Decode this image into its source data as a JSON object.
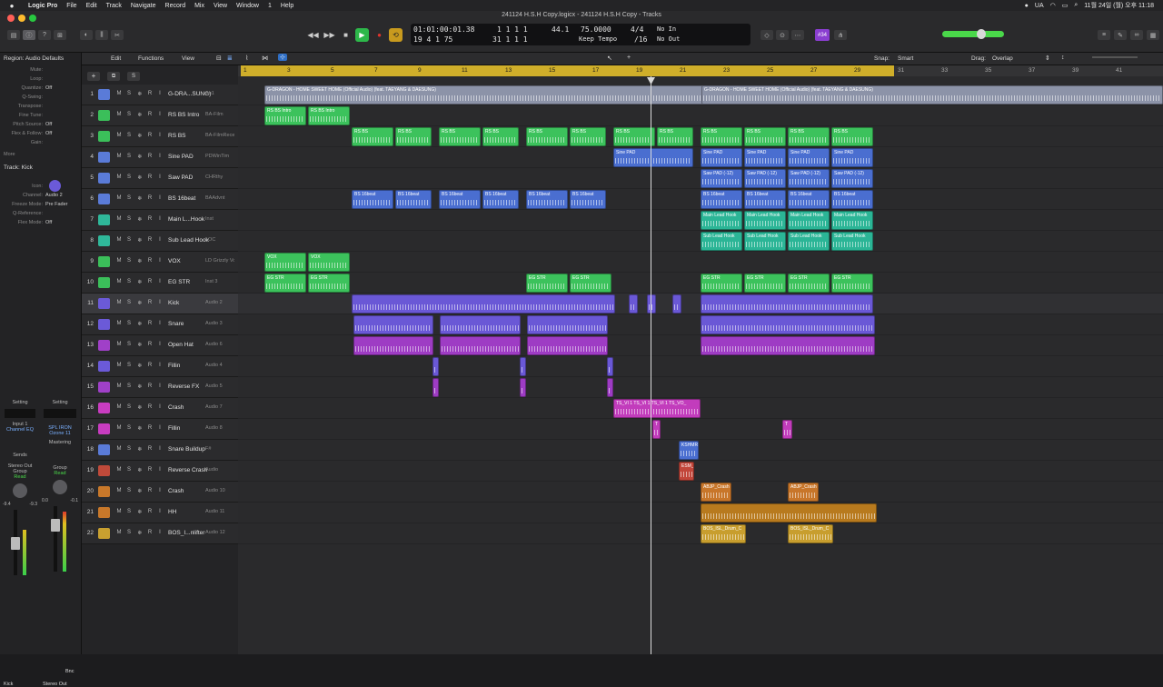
{
  "menubar": {
    "apple": "",
    "items": [
      "Logic Pro",
      "File",
      "Edit",
      "Track",
      "Navigate",
      "Record",
      "Mix",
      "View",
      "Window",
      "1",
      "Help"
    ],
    "right_ua": "UA",
    "datetime": "11월 24일 (월) 오후 11:18"
  },
  "window": {
    "title": "241124 H.S.H Copy.logicx - 241124 H.S.H Copy - Tracks"
  },
  "lcd": {
    "time": "01:01:00:01.38",
    "bars": "19 4 1   75",
    "pos_top": "1  1  1      1",
    "pos_bot": "31  1  1      1",
    "tempo_small": "44.1",
    "tempo": "75.0000",
    "tempo_label": "Keep Tempo",
    "sig": "4/4",
    "div": "/16",
    "in": "No In",
    "out": "No Out"
  },
  "toolbar": {
    "badge": "#34",
    "edit": "Edit",
    "functions": "Functions",
    "view": "View",
    "snap_label": "Snap:",
    "snap_value": "Smart",
    "drag_label": "Drag:",
    "drag_value": "Overlap"
  },
  "inspector": {
    "region_header": "Region: Audio Defaults",
    "region_rows": [
      {
        "k": "Mute:",
        "v": ""
      },
      {
        "k": "Loop:",
        "v": ""
      },
      {
        "k": "Quantize:",
        "v": "Off"
      },
      {
        "k": "Q-Swing:",
        "v": ""
      },
      {
        "k": "Transpose:",
        "v": ""
      },
      {
        "k": "Fine Tune:",
        "v": ""
      },
      {
        "k": "Pitch Source:",
        "v": "Off"
      },
      {
        "k": "Flex & Follow:",
        "v": "Off"
      },
      {
        "k": "Gain:",
        "v": ""
      }
    ],
    "more": "More",
    "track_header": "Track: Kick",
    "track_rows": [
      {
        "k": "Icon:",
        "v": ""
      },
      {
        "k": "Channel:",
        "v": "Audio 2"
      },
      {
        "k": "Freeze Mode:",
        "v": "Pre Fader"
      },
      {
        "k": "Q-Reference:",
        "v": ""
      },
      {
        "k": "Flex Mode:",
        "v": "Off"
      }
    ],
    "strip_left": {
      "setting": "Setting",
      "eq": "EQ",
      "input": "Input 1",
      "plugin": "Channel EQ",
      "sends": "Sends",
      "output": "Stereo Out",
      "group": "Group",
      "read": "Read",
      "vol": "-9.4",
      "vol2": "-9.3",
      "name": "Kick"
    },
    "strip_right": {
      "setting": "Setting",
      "plugin1": "SPL IRON",
      "plugin2": "Ozone 11",
      "mastering": "Mastering",
      "group": "Group",
      "read": "Read",
      "vol": "0.0",
      "vol2": "-0.1",
      "bnc": "Bnc",
      "name": "Stereo Out"
    }
  },
  "tracks": [
    {
      "num": "1",
      "name": "G-DRA...SUNG)",
      "plug": "Au1",
      "color": "#5a7bd8"
    },
    {
      "num": "2",
      "name": "RS BS Intro",
      "plug": "BA-Film",
      "color": "#3bbf5a"
    },
    {
      "num": "3",
      "name": "RS BS",
      "plug": "BA-FilmRece",
      "color": "#3bbf5a"
    },
    {
      "num": "4",
      "name": "Sine PAD",
      "plug": "PDWinTim",
      "color": "#5a7bd8"
    },
    {
      "num": "5",
      "name": "Saw PAD",
      "plug": "CHRthy",
      "color": "#5a7bd8"
    },
    {
      "num": "6",
      "name": "BS 16beat",
      "plug": "BAAdvnt",
      "color": "#5a7bd8"
    },
    {
      "num": "7",
      "name": "Main L...Hook",
      "plug": "Inst",
      "color": "#2fb89a"
    },
    {
      "num": "8",
      "name": "Sub Lead Hook",
      "plug": "LOC",
      "color": "#2fb89a"
    },
    {
      "num": "9",
      "name": "VOX",
      "plug": "LD Grizzly Vox",
      "color": "#3bbf5a"
    },
    {
      "num": "10",
      "name": "EG STR",
      "plug": "Inst 3",
      "color": "#3bbf5a"
    },
    {
      "num": "11",
      "name": "Kick",
      "plug": "Audio 2",
      "color": "#6b5ad8"
    },
    {
      "num": "12",
      "name": "Snare",
      "plug": "Audio 3",
      "color": "#6b5ad8"
    },
    {
      "num": "13",
      "name": "Open Hat",
      "plug": "Audio 6",
      "color": "#a040c8"
    },
    {
      "num": "14",
      "name": "Fillin",
      "plug": "Audio 4",
      "color": "#6b5ad8"
    },
    {
      "num": "15",
      "name": "Reverse FX",
      "plug": "Audio 5",
      "color": "#a040c8"
    },
    {
      "num": "16",
      "name": "Crash",
      "plug": "Audio 7",
      "color": "#c83cc0"
    },
    {
      "num": "17",
      "name": "Fillin",
      "plug": "Audio 8",
      "color": "#c83cc0"
    },
    {
      "num": "18",
      "name": "Snare Buildup",
      "plug": "F#",
      "color": "#5a7bd8"
    },
    {
      "num": "19",
      "name": "Reverse Crash",
      "plug": "Audio",
      "color": "#c04a3a"
    },
    {
      "num": "20",
      "name": "Crash",
      "plug": "Audio 10",
      "color": "#c8782a"
    },
    {
      "num": "21",
      "name": "HH",
      "plug": "Audio 11",
      "color": "#c8782a"
    },
    {
      "num": "22",
      "name": "BOS_I...nlifter",
      "plug": "Audio 12",
      "color": "#c8a030"
    }
  ],
  "ruler": [
    "1",
    "3",
    "5",
    "7",
    "9",
    "11",
    "13",
    "15",
    "17",
    "19",
    "21",
    "23",
    "25",
    "27",
    "29",
    "31",
    "33",
    "35",
    "37",
    "39",
    "41"
  ],
  "regions": [
    {
      "lane": 0,
      "start": 29,
      "end": 1018,
      "color": "#8c93a8",
      "label": "G-DRAGON - HOME SWEET HOME (Official Audio) (feat. TAEYANG & DAESUNG)"
    },
    {
      "lane": 0,
      "start": 510,
      "end": 1018,
      "color": "#8c93a8",
      "label": "G-DRAGON - HOME SWEET HOME (Official Audio) (feat. TAEYANG & DAESUNG)"
    },
    {
      "lane": 1,
      "start": 29,
      "end": 75,
      "color": "#3cc25c",
      "label": "RS BS Intro"
    },
    {
      "lane": 1,
      "start": 77,
      "end": 123,
      "color": "#3cc25c",
      "label": "RS BS Intro"
    },
    {
      "lane": 2,
      "start": 125,
      "end": 171,
      "color": "#3cc25c",
      "label": "RS BS"
    },
    {
      "lane": 2,
      "start": 173,
      "end": 213,
      "color": "#3cc25c",
      "label": "RS BS"
    },
    {
      "lane": 2,
      "start": 221,
      "end": 267,
      "color": "#3cc25c",
      "label": "RS BS"
    },
    {
      "lane": 2,
      "start": 269,
      "end": 309,
      "color": "#3cc25c",
      "label": "RS BS"
    },
    {
      "lane": 2,
      "start": 317,
      "end": 363,
      "color": "#3cc25c",
      "label": "RS BS"
    },
    {
      "lane": 2,
      "start": 365,
      "end": 405,
      "color": "#3cc25c",
      "label": "RS BS"
    },
    {
      "lane": 2,
      "start": 413,
      "end": 459,
      "color": "#3cc25c",
      "label": "RS BS"
    },
    {
      "lane": 2,
      "start": 461,
      "end": 501,
      "color": "#3cc25c",
      "label": "RS BS"
    },
    {
      "lane": 2,
      "start": 509,
      "end": 555,
      "color": "#3cc25c",
      "label": "RS BS"
    },
    {
      "lane": 2,
      "start": 557,
      "end": 603,
      "color": "#3cc25c",
      "label": "RS BS"
    },
    {
      "lane": 2,
      "start": 605,
      "end": 651,
      "color": "#3cc25c",
      "label": "RS BS"
    },
    {
      "lane": 2,
      "start": 653,
      "end": 699,
      "color": "#3cc25c",
      "label": "RS BS"
    },
    {
      "lane": 3,
      "start": 413,
      "end": 501,
      "color": "#4a6ed0",
      "label": "Sine PAD"
    },
    {
      "lane": 3,
      "start": 509,
      "end": 555,
      "color": "#4a6ed0",
      "label": "Sine PAD"
    },
    {
      "lane": 3,
      "start": 557,
      "end": 603,
      "color": "#4a6ed0",
      "label": "Sine PAD"
    },
    {
      "lane": 3,
      "start": 605,
      "end": 651,
      "color": "#4a6ed0",
      "label": "Sine PAD"
    },
    {
      "lane": 3,
      "start": 653,
      "end": 699,
      "color": "#4a6ed0",
      "label": "Sine PAD"
    },
    {
      "lane": 4,
      "start": 509,
      "end": 555,
      "color": "#4a6ed0",
      "label": "Saw PAD (-12)"
    },
    {
      "lane": 4,
      "start": 557,
      "end": 603,
      "color": "#4a6ed0",
      "label": "Saw PAD (-12)"
    },
    {
      "lane": 4,
      "start": 605,
      "end": 651,
      "color": "#4a6ed0",
      "label": "Saw PAD (-12)"
    },
    {
      "lane": 4,
      "start": 653,
      "end": 699,
      "color": "#4a6ed0",
      "label": "Saw PAD (-12)"
    },
    {
      "lane": 5,
      "start": 125,
      "end": 171,
      "color": "#4a6ed0",
      "label": "BS 16beat"
    },
    {
      "lane": 5,
      "start": 173,
      "end": 213,
      "color": "#4a6ed0",
      "label": "BS 16beat"
    },
    {
      "lane": 5,
      "start": 221,
      "end": 267,
      "color": "#4a6ed0",
      "label": "BS 16beat"
    },
    {
      "lane": 5,
      "start": 269,
      "end": 309,
      "color": "#4a6ed0",
      "label": "BS 16beat"
    },
    {
      "lane": 5,
      "start": 317,
      "end": 363,
      "color": "#4a6ed0",
      "label": "BS 16beat"
    },
    {
      "lane": 5,
      "start": 365,
      "end": 405,
      "color": "#4a6ed0",
      "label": "BS 16beat"
    },
    {
      "lane": 5,
      "start": 509,
      "end": 555,
      "color": "#4a6ed0",
      "label": "BS 16beat"
    },
    {
      "lane": 5,
      "start": 557,
      "end": 603,
      "color": "#4a6ed0",
      "label": "BS 16beat"
    },
    {
      "lane": 5,
      "start": 605,
      "end": 651,
      "color": "#4a6ed0",
      "label": "BS 16beat"
    },
    {
      "lane": 5,
      "start": 653,
      "end": 699,
      "color": "#4a6ed0",
      "label": "BS 16beat"
    },
    {
      "lane": 6,
      "start": 509,
      "end": 555,
      "color": "#2bb596",
      "label": "Main Lead Hook"
    },
    {
      "lane": 6,
      "start": 557,
      "end": 603,
      "color": "#2bb596",
      "label": "Main Lead Hook"
    },
    {
      "lane": 6,
      "start": 605,
      "end": 651,
      "color": "#2bb596",
      "label": "Main Lead Hook"
    },
    {
      "lane": 6,
      "start": 653,
      "end": 699,
      "color": "#2bb596",
      "label": "Main Lead Hook"
    },
    {
      "lane": 7,
      "start": 509,
      "end": 555,
      "color": "#2bb596",
      "label": "Sub Lead Hook"
    },
    {
      "lane": 7,
      "start": 557,
      "end": 603,
      "color": "#2bb596",
      "label": "Sub Lead Hook"
    },
    {
      "lane": 7,
      "start": 605,
      "end": 651,
      "color": "#2bb596",
      "label": "Sub Lead Hook"
    },
    {
      "lane": 7,
      "start": 653,
      "end": 699,
      "color": "#2bb596",
      "label": "Sub Lead Hook"
    },
    {
      "lane": 8,
      "start": 29,
      "end": 75,
      "color": "#3cc25c",
      "label": "VOX"
    },
    {
      "lane": 8,
      "start": 77,
      "end": 123,
      "color": "#3cc25c",
      "label": "VOX"
    },
    {
      "lane": 9,
      "start": 29,
      "end": 75,
      "color": "#3cc25c",
      "label": "EG STR"
    },
    {
      "lane": 9,
      "start": 77,
      "end": 123,
      "color": "#3cc25c",
      "label": "EG STR"
    },
    {
      "lane": 9,
      "start": 317,
      "end": 363,
      "color": "#3cc25c",
      "label": "EG STR"
    },
    {
      "lane": 9,
      "start": 365,
      "end": 411,
      "color": "#3cc25c",
      "label": "EG STR"
    },
    {
      "lane": 9,
      "start": 509,
      "end": 555,
      "color": "#3cc25c",
      "label": "EG STR"
    },
    {
      "lane": 9,
      "start": 557,
      "end": 603,
      "color": "#3cc25c",
      "label": "EG STR"
    },
    {
      "lane": 9,
      "start": 605,
      "end": 651,
      "color": "#3cc25c",
      "label": "EG STR"
    },
    {
      "lane": 9,
      "start": 653,
      "end": 699,
      "color": "#3cc25c",
      "label": "EG STR"
    },
    {
      "lane": 10,
      "start": 125,
      "end": 415,
      "color": "#6a58d6",
      "label": ""
    },
    {
      "lane": 10,
      "start": 430,
      "end": 440,
      "color": "#6a58d6",
      "label": ""
    },
    {
      "lane": 10,
      "start": 450,
      "end": 460,
      "color": "#6a58d6",
      "label": ""
    },
    {
      "lane": 10,
      "start": 478,
      "end": 488,
      "color": "#6a58d6",
      "label": ""
    },
    {
      "lane": 10,
      "start": 509,
      "end": 699,
      "color": "#6a58d6",
      "label": ""
    },
    {
      "lane": 11,
      "start": 127,
      "end": 215,
      "color": "#6a58d6",
      "label": ""
    },
    {
      "lane": 11,
      "start": 222,
      "end": 311,
      "color": "#6a58d6",
      "label": ""
    },
    {
      "lane": 11,
      "start": 318,
      "end": 407,
      "color": "#6a58d6",
      "label": ""
    },
    {
      "lane": 11,
      "start": 509,
      "end": 701,
      "color": "#6a58d6",
      "label": ""
    },
    {
      "lane": 12,
      "start": 127,
      "end": 215,
      "color": "#9e3cc4",
      "label": ""
    },
    {
      "lane": 12,
      "start": 222,
      "end": 311,
      "color": "#9e3cc4",
      "label": ""
    },
    {
      "lane": 12,
      "start": 318,
      "end": 407,
      "color": "#9e3cc4",
      "label": ""
    },
    {
      "lane": 12,
      "start": 509,
      "end": 701,
      "color": "#9e3cc4",
      "label": ""
    },
    {
      "lane": 13,
      "start": 214,
      "end": 221,
      "color": "#6a58d6",
      "label": ""
    },
    {
      "lane": 13,
      "start": 310,
      "end": 317,
      "color": "#6a58d6",
      "label": ""
    },
    {
      "lane": 13,
      "start": 406,
      "end": 413,
      "color": "#6a58d6",
      "label": ""
    },
    {
      "lane": 14,
      "start": 214,
      "end": 221,
      "color": "#9e3cc4",
      "label": ""
    },
    {
      "lane": 14,
      "start": 310,
      "end": 317,
      "color": "#9e3cc4",
      "label": ""
    },
    {
      "lane": 14,
      "start": 406,
      "end": 413,
      "color": "#9e3cc4",
      "label": ""
    },
    {
      "lane": 15,
      "start": 413,
      "end": 509,
      "color": "#c23cbc",
      "label": "TS_VI 1  TS_VI 1  TS_VI 1  TS_VO_"
    },
    {
      "lane": 16,
      "start": 456,
      "end": 465,
      "color": "#c23cbc",
      "label": "T"
    },
    {
      "lane": 16,
      "start": 599,
      "end": 610,
      "color": "#c23cbc",
      "label": "T"
    },
    {
      "lane": 17,
      "start": 485,
      "end": 507,
      "color": "#4a6ed0",
      "label": "KSHMR"
    },
    {
      "lane": 18,
      "start": 485,
      "end": 502,
      "color": "#c2463a",
      "label": "ESM_"
    },
    {
      "lane": 19,
      "start": 509,
      "end": 543,
      "color": "#c8762a",
      "label": "ABJP_Crash"
    },
    {
      "lane": 19,
      "start": 605,
      "end": 639,
      "color": "#c8762a",
      "label": "ABJP_Crash"
    },
    {
      "lane": 20,
      "start": 509,
      "end": 703,
      "color": "#b87a1e",
      "label": ""
    },
    {
      "lane": 21,
      "start": 509,
      "end": 559,
      "color": "#c89e2e",
      "label": "BOS_ISL_Drum_C"
    },
    {
      "lane": 21,
      "start": 605,
      "end": 655,
      "color": "#c89e2e",
      "label": "BOS_ISL_Drum_C"
    }
  ]
}
